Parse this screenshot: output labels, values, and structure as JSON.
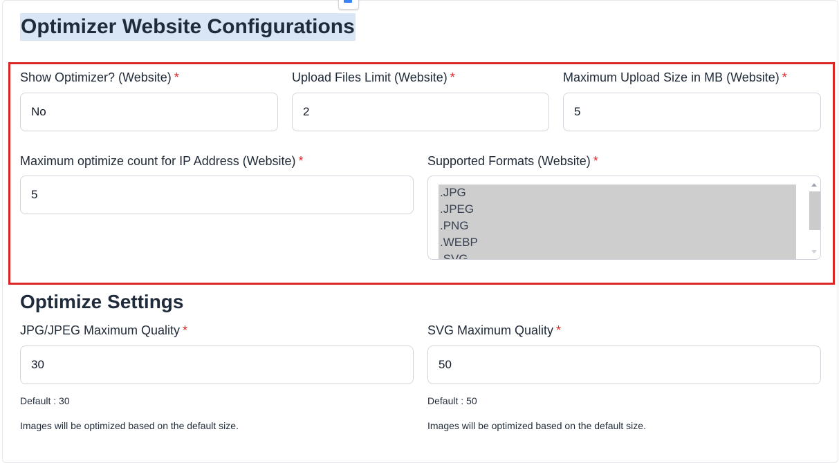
{
  "page_title": "Optimizer Website Configurations",
  "floating_icon": "image-close-icon",
  "website_config": {
    "show_optimizer": {
      "label": "Show Optimizer? (Website)",
      "required": "*",
      "value": "No"
    },
    "upload_files_limit": {
      "label": "Upload Files Limit (Website)",
      "required": "*",
      "value": "2"
    },
    "max_upload_size": {
      "label": "Maximum Upload Size in MB (Website)",
      "required": "*",
      "value": "5"
    },
    "max_optimize_count": {
      "label": "Maximum optimize count for IP Address (Website)",
      "required": "*",
      "value": "5"
    },
    "supported_formats": {
      "label": "Supported Formats (Website)",
      "required": "*",
      "options": [
        ".JPG",
        ".JPEG",
        ".PNG",
        ".WEBP",
        ".SVG"
      ]
    }
  },
  "optimize_settings": {
    "title": "Optimize Settings",
    "jpg_quality": {
      "label": "JPG/JPEG Maximum Quality",
      "required": "*",
      "value": "30",
      "default": "Default : 30",
      "note": "Images will be optimized based on the default size."
    },
    "svg_quality": {
      "label": "SVG Maximum Quality",
      "required": "*",
      "value": "50",
      "default": "Default : 50",
      "note": "Images will be optimized based on the default size."
    }
  },
  "colors": {
    "required": "#dc2626",
    "highlight_border": "#dc2626",
    "title_highlight": "#d9e6f6",
    "selected_option": "#cecece"
  }
}
